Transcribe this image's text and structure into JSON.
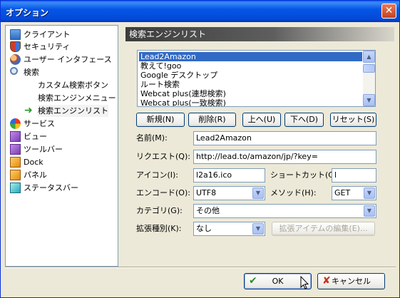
{
  "window": {
    "title": "オプション",
    "close_glyph": "✕"
  },
  "sidebar": {
    "items": [
      {
        "label": "クライアント",
        "icon": "monitor-icon"
      },
      {
        "label": "セキュリティ",
        "icon": "shield-icon"
      },
      {
        "label": "ユーザー インタフェース",
        "icon": "users-icon"
      },
      {
        "label": "検索",
        "icon": "search-icon"
      },
      {
        "label": "カスタム検索ボタン",
        "icon": ""
      },
      {
        "label": "検索エンジンメニュー",
        "icon": ""
      },
      {
        "label": "検索エンジンリスト",
        "icon": "arrow-right-icon"
      },
      {
        "label": "サービス",
        "icon": "services-icon"
      },
      {
        "label": "ビュー",
        "icon": "cube-icon"
      },
      {
        "label": "ツールバー",
        "icon": "cube-icon"
      },
      {
        "label": "Dock",
        "icon": "cube-icon"
      },
      {
        "label": "パネル",
        "icon": "cube-icon"
      },
      {
        "label": "ステータスバー",
        "icon": "cube-icon"
      }
    ]
  },
  "panel": {
    "title": "検索エンジンリスト"
  },
  "engine_list": {
    "items": [
      "Lead2Amazon",
      "教えて!goo",
      "Google デスクトップ",
      "ルート検索",
      "Webcat plus(連想検索)",
      "Webcat plus(一致検索)"
    ],
    "selected": "Lead2Amazon"
  },
  "list_buttons": {
    "new": "新規(N)",
    "delete": "削除(R)",
    "up": "上へ(U)",
    "down": "下へ(D)",
    "reset": "リセット(S)"
  },
  "form": {
    "name_label": "名前(M):",
    "name_value": "Lead2Amazon",
    "request_label": "リクエスト(Q):",
    "request_value": "http://lead.to/amazon/jp/?key=",
    "icon_label": "アイコン(I):",
    "icon_value": "l2a16.ico",
    "shortcut_label": "ショートカット(C):",
    "shortcut_value": "l",
    "encode_label": "エンコード(O):",
    "encode_value": "UTF8",
    "method_label": "メソッド(H):",
    "method_value": "GET",
    "category_label": "カテゴリ(G):",
    "category_value": "その他",
    "ext_type_label": "拡張種別(K):",
    "ext_type_value": "なし",
    "edit_ext_label": "拡張アイテムの編集(E)..."
  },
  "footer": {
    "ok": "OK",
    "cancel": "キャンセル"
  }
}
